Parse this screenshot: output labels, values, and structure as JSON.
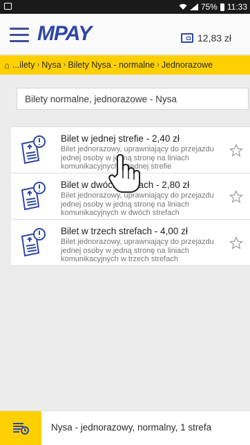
{
  "statusbar": {
    "battery": "75%",
    "time": "11:33"
  },
  "header": {
    "logo": "MPAY",
    "balance": "12,83 zł"
  },
  "breadcrumb": {
    "items": [
      "...ilety",
      "Nysa",
      "Bilety Nysa - normalne",
      "Jednorazowe"
    ]
  },
  "search": {
    "value": "Bilety normalne, jednorazowe - Nysa"
  },
  "tickets": [
    {
      "title": "Bilet w jednej strefie - 2,40 zł",
      "description": "Bilet jednorazowy, uprawniający do przejazdu jednej osoby w jedną stronę na liniach komunikacyjnych w jednej strefie"
    },
    {
      "title": "Bilet w dwóch strefach - 2,80 zł",
      "description": "Bilet jednorazowy, uprawniający do przejazdu jednej osoby w jedną stronę na liniach komunikacyjnych w dwóch strefach"
    },
    {
      "title": "Bilet w trzech strefach - 4,00 zł",
      "description": "Bilet jednorazowy, uprawniający do przejazdu jednej osoby w jedną stronę na liniach komunikacyjnych w trzech strefach"
    }
  ],
  "bottom_bar": {
    "text": "Nysa - jednorazowy, normalny, 1 strefa"
  },
  "colors": {
    "accent": "#ffd000",
    "brand": "#2e46a3"
  },
  "icons": [
    "menu-icon",
    "wallet-icon",
    "home-icon",
    "ticket-icon",
    "star-icon",
    "history-icon",
    "hand-pointer-icon"
  ]
}
